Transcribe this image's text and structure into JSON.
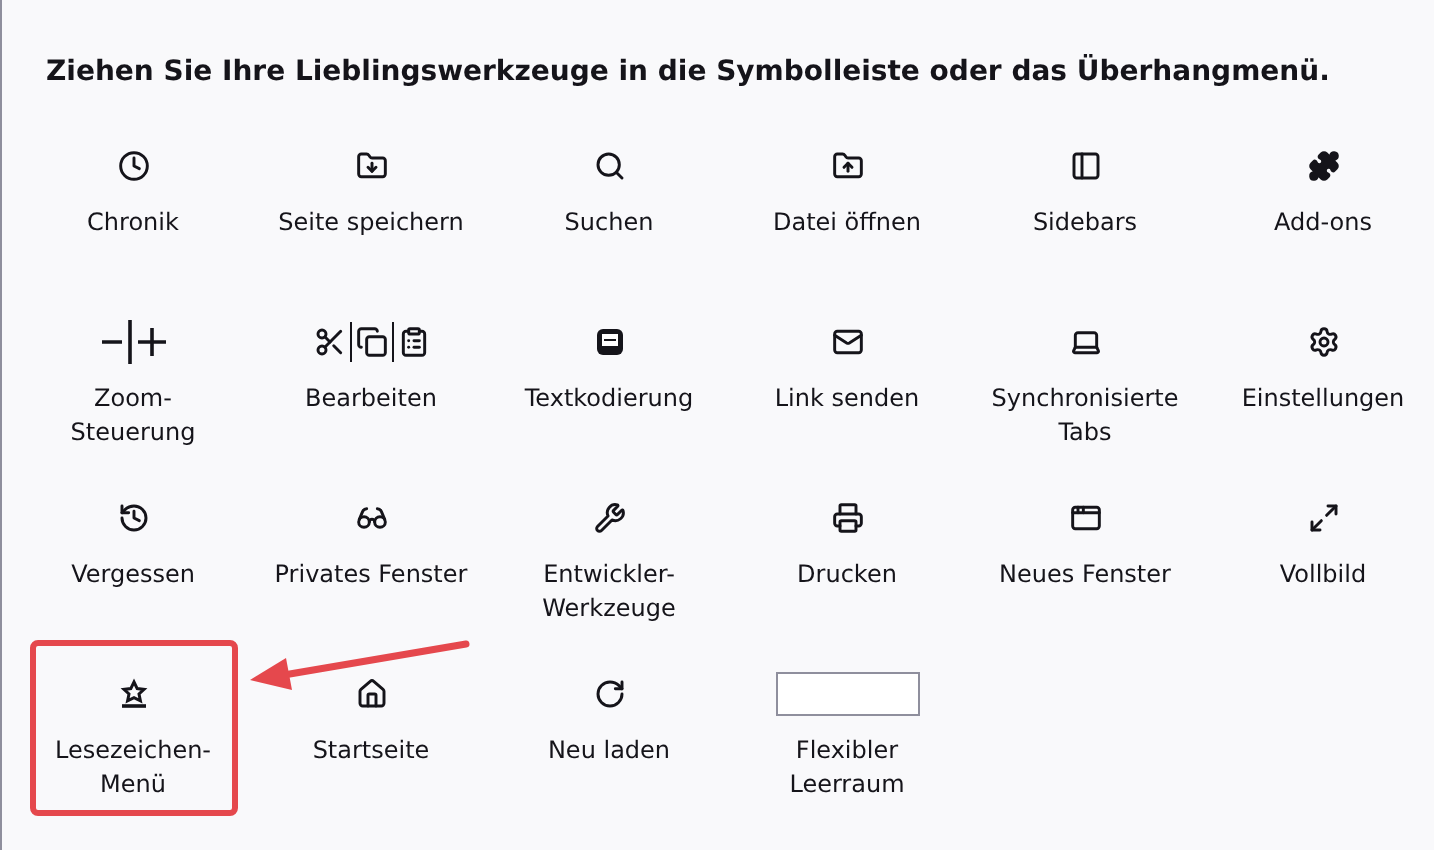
{
  "heading": "Ziehen Sie Ihre Lieblingswerkzeuge in die Symbolleiste oder das Überhangmenü.",
  "items": [
    {
      "kind": "tool",
      "label": "Chronik",
      "highlighted": false
    },
    {
      "kind": "tool",
      "label": "Seite speichern",
      "highlighted": false
    },
    {
      "kind": "tool",
      "label": "Suchen",
      "highlighted": false
    },
    {
      "kind": "tool",
      "label": "Datei öffnen",
      "highlighted": false
    },
    {
      "kind": "tool",
      "label": "Sidebars",
      "highlighted": false
    },
    {
      "kind": "tool",
      "label": "Add-ons",
      "highlighted": false
    },
    {
      "kind": "tool",
      "label": "Zoom-\nSteuerung",
      "highlighted": false
    },
    {
      "kind": "tool",
      "label": "Bearbeiten",
      "highlighted": false
    },
    {
      "kind": "tool",
      "label": "Textkodierung",
      "highlighted": false
    },
    {
      "kind": "tool",
      "label": "Link senden",
      "highlighted": false
    },
    {
      "kind": "tool",
      "label": "Synchronisierte\nTabs",
      "highlighted": false
    },
    {
      "kind": "tool",
      "label": "Einstellungen",
      "highlighted": false
    },
    {
      "kind": "tool",
      "label": "Vergessen",
      "highlighted": false
    },
    {
      "kind": "tool",
      "label": "Privates Fenster",
      "highlighted": false
    },
    {
      "kind": "tool",
      "label": "Entwickler-\nWerkzeuge",
      "highlighted": false
    },
    {
      "kind": "tool",
      "label": "Drucken",
      "highlighted": false
    },
    {
      "kind": "tool",
      "label": "Neues Fenster",
      "highlighted": false
    },
    {
      "kind": "tool",
      "label": "Vollbild",
      "highlighted": false
    },
    {
      "kind": "tool",
      "label": "Lesezeichen-\nMenü",
      "highlighted": true
    },
    {
      "kind": "tool",
      "label": "Startseite",
      "highlighted": false
    },
    {
      "kind": "tool",
      "label": "Neu laden",
      "highlighted": false
    },
    {
      "kind": "spacer",
      "label": "Flexibler\nLeerraum",
      "highlighted": false
    }
  ]
}
